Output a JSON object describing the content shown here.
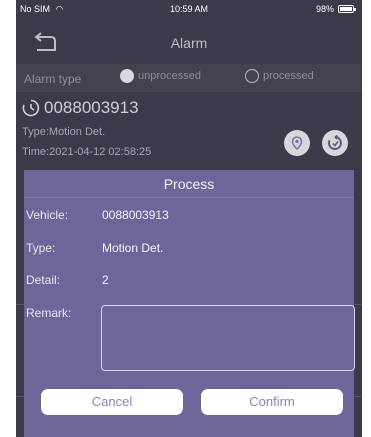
{
  "status_bar": {
    "carrier": "No SIM",
    "time": "10:59 AM",
    "battery": "98%"
  },
  "nav": {
    "title": "Alarm",
    "back_icon": "back-arrow-icon"
  },
  "filter": {
    "label": "Alarm type",
    "options": [
      {
        "label": "unprocessed",
        "checked": true
      },
      {
        "label": "processed",
        "checked": false
      }
    ]
  },
  "alarm": {
    "id": "0088003913",
    "type_line": "Type:Motion Det.",
    "time_line": "Time:2021-04-12 02:58:25"
  },
  "dialog": {
    "title": "Process",
    "vehicle_label": "Vehicle:",
    "vehicle_value": "0088003913",
    "type_label": "Type:",
    "type_value": "Motion Det.",
    "detail_label": "Detail:",
    "detail_value": "2",
    "remark_label": "Remark:",
    "remark_value": "",
    "cancel_label": "Cancel",
    "confirm_label": "Confirm"
  },
  "colors": {
    "background": "#3a3a48",
    "dialog": "#6e6699",
    "button": "#ffffff",
    "button_text": "#8a83b8"
  }
}
